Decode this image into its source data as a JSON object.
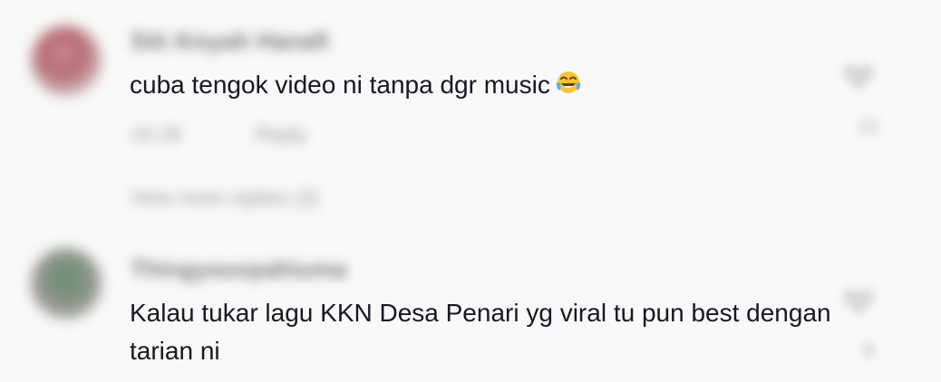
{
  "comments": [
    {
      "username": "Siti Aisyah Hanafi",
      "text": "cuba tengok video ni tanpa dgr music",
      "emoji": "face-with-tears-of-joy",
      "time": "10-28",
      "reply_label": "Reply",
      "view_replies": "View more replies (3)",
      "likes": "12"
    },
    {
      "username": "Thingyouvpahiuma",
      "text": "Kalau tukar lagu KKN Desa Penari yg viral tu pun best dengan tarian ni",
      "likes": "8"
    }
  ],
  "colors": {
    "background": "#f8f8f8",
    "text": "#161823",
    "muted": "#9a9a9a"
  },
  "icons": [
    "avatar",
    "face-with-tears-of-joy-emoji",
    "heart-icon"
  ]
}
